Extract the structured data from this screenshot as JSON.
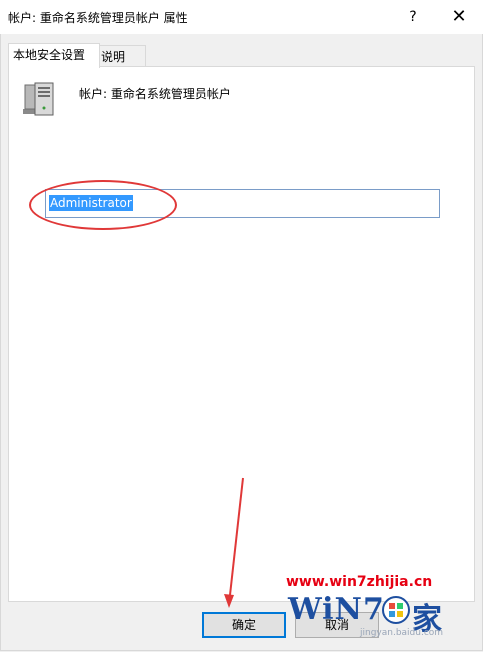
{
  "window": {
    "title": "帐户: 重命名系统管理员帐户 属性",
    "help_label": "?",
    "close_label": "✕"
  },
  "tabs": [
    {
      "label": "本地安全设置",
      "active": true
    },
    {
      "label": "说明",
      "active": false
    }
  ],
  "panel": {
    "policy_label": "帐户: 重命名系统管理员帐户",
    "policy_icon": "server-computer-icon",
    "input_value": "Administrator"
  },
  "buttons": {
    "ok_label": "确定",
    "cancel_label": "取消"
  },
  "watermark": {
    "url": "www.win7zhijia.cn",
    "logo_text": "WiN7",
    "logo_suffix": "家",
    "bottom_text": "jingyan.baidu.com"
  },
  "colors": {
    "accent": "#0078d7",
    "selection": "#3399ff",
    "annotation": "#e03838"
  }
}
